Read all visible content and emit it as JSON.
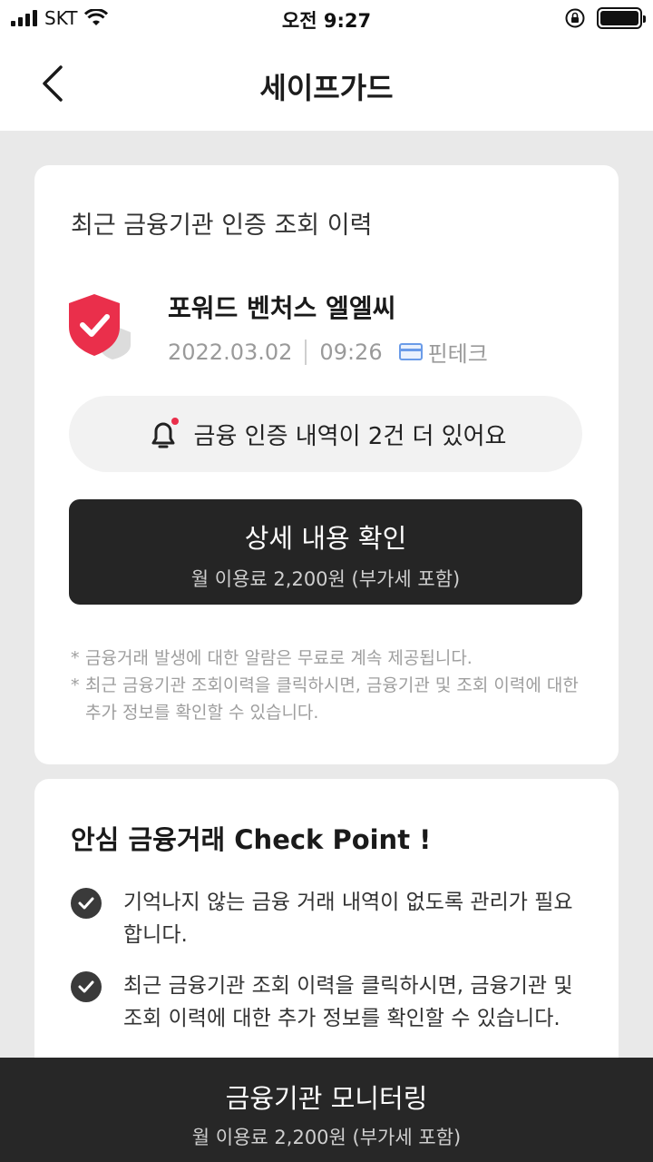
{
  "status_bar": {
    "carrier": "SKT",
    "time": "오전 9:27"
  },
  "header": {
    "title": "세이프가드"
  },
  "recent_auth": {
    "section_title": "최근 금융기관 인증 조회 이력",
    "org_name": "포워드 벤처스 엘엘씨",
    "date": "2022.03.02",
    "time": "09:26",
    "category": "핀테크",
    "notice_text": "금융 인증 내역이 2건 더 있어요",
    "detail_button_label": "상세 내용 확인",
    "detail_button_sub": "월 이용료 2,200원 (부가세 포함)",
    "notes": [
      "금융거래 발생에 대한 알람은 무료로 계속 제공됩니다.",
      "최근 금융기관 조회이력을 클릭하시면, 금융기관 및 조회 이력에 대한 추가 정보를 확인할 수 있습니다."
    ]
  },
  "check_point": {
    "title": "안심 금융거래 Check Point !",
    "items": [
      "기억나지 않는 금융 거래 내역이 없도록 관리가 필요합니다.",
      "최근 금융기관 조회 이력을 클릭하시면, 금융기관 및 조회 이력에 대한 추가 정보를 확인할 수 있습니다."
    ]
  },
  "bottom_bar": {
    "label": "금융기관 모니터링",
    "sub": "월 이용료 2,200원 (부가세 포함)"
  },
  "colors": {
    "accent_red": "#ea2f4b",
    "dark_button": "#252525",
    "fintech_blue": "#6a9be8"
  }
}
